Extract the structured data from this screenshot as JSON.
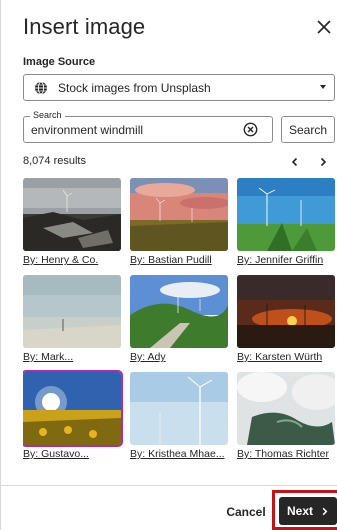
{
  "dialog": {
    "title": "Insert image",
    "close_icon": "close-icon"
  },
  "source": {
    "label": "Image Source",
    "selected": "Stock images from Unsplash",
    "icon": "globe-icon"
  },
  "search": {
    "legend": "Search",
    "value": "environment windmill",
    "button_label": "Search"
  },
  "results": {
    "count": "8,074 results"
  },
  "images": [
    {
      "credit": "By: Henry & Co.",
      "selected": false
    },
    {
      "credit": "By: Bastian Pudill",
      "selected": false
    },
    {
      "credit": "By: Jennifer Griffin",
      "selected": false
    },
    {
      "credit": "By: Mark...",
      "selected": false
    },
    {
      "credit": "By: Ady",
      "selected": false
    },
    {
      "credit": "By: Karsten Würth",
      "selected": false
    },
    {
      "credit": "By: Gustavo...",
      "selected": true
    },
    {
      "credit": "By: Kristhea Mhae...",
      "selected": false
    },
    {
      "credit": "By: Thomas Richter",
      "selected": false
    }
  ],
  "footer": {
    "cancel_label": "Cancel",
    "next_label": "Next"
  },
  "colors": {
    "primary_button": "#262626",
    "selection_outline": "#b02ab0",
    "highlight_frame": "#c0141b"
  }
}
